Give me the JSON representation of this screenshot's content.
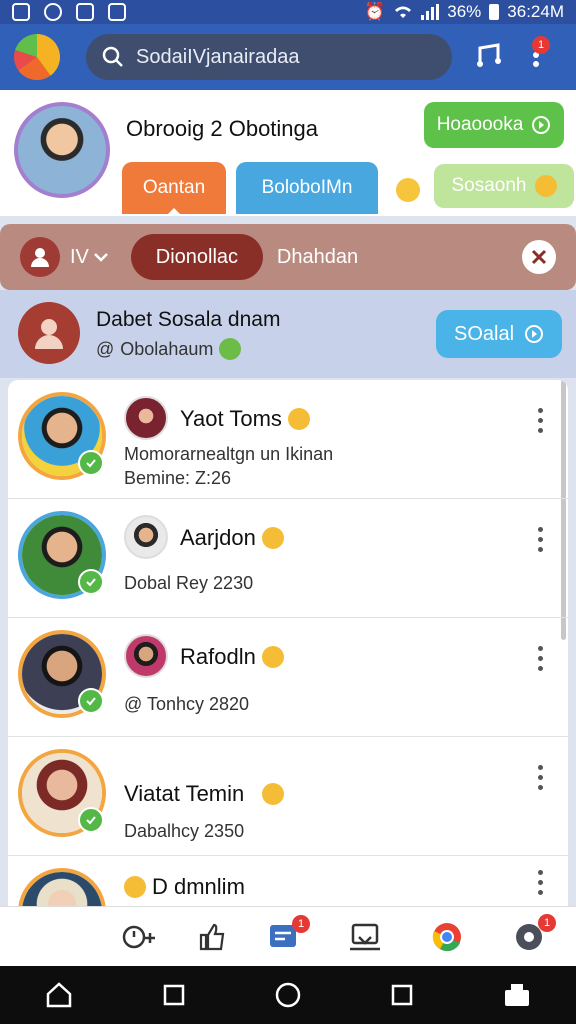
{
  "status": {
    "battery": "36%",
    "time": "36:24M"
  },
  "appbar": {
    "search_text": "SodaiIVjanairadaa",
    "notification_count": "1",
    "logo": "app-logo"
  },
  "profile": {
    "name": "Obrooig 2 Obotinga",
    "action_button": "Hoaoooka",
    "tabs": [
      "Oantan",
      "BoloboIMn"
    ],
    "chip": "Sosaonh"
  },
  "filter": {
    "selector": "IV",
    "active_pill": "Dionollac",
    "label": "Dhahdan"
  },
  "suggestion": {
    "name": "Dabet Sosala dnam",
    "subtitle": "Obolahaum",
    "button": "SOalal"
  },
  "list": {
    "items": [
      {
        "name": "Yaot Toms",
        "line1": "Momorarnealtgn un Ikinan",
        "line2": "Bemine: Z:26",
        "has_small_avatar": true
      },
      {
        "name": "Aarjdon",
        "line1": "Dobal Rey 2230",
        "line2": "",
        "has_small_avatar": true
      },
      {
        "name": "Rafodln",
        "line1": "Tonhcy 2820",
        "line2": "",
        "has_small_avatar": true
      },
      {
        "name": "Viatat Temin",
        "line1": "Dabalhcy 2350",
        "line2": "",
        "has_small_avatar": false
      },
      {
        "name": "D dmnlim",
        "line1": "",
        "line2": "",
        "has_small_avatar": false
      }
    ]
  },
  "bottomnav": {
    "items": [
      "history-icon",
      "likes-icon",
      "messages-icon",
      "inbox-icon",
      "browser-icon",
      "settings-icon"
    ],
    "message_badge": "1",
    "settings_badge": "1"
  },
  "colors": {
    "appbar": "#3160b8",
    "accent_green": "#5ec14a",
    "accent_orange": "#f07a3a",
    "accent_blue": "#49a7e0",
    "filter": "#b98b80"
  }
}
